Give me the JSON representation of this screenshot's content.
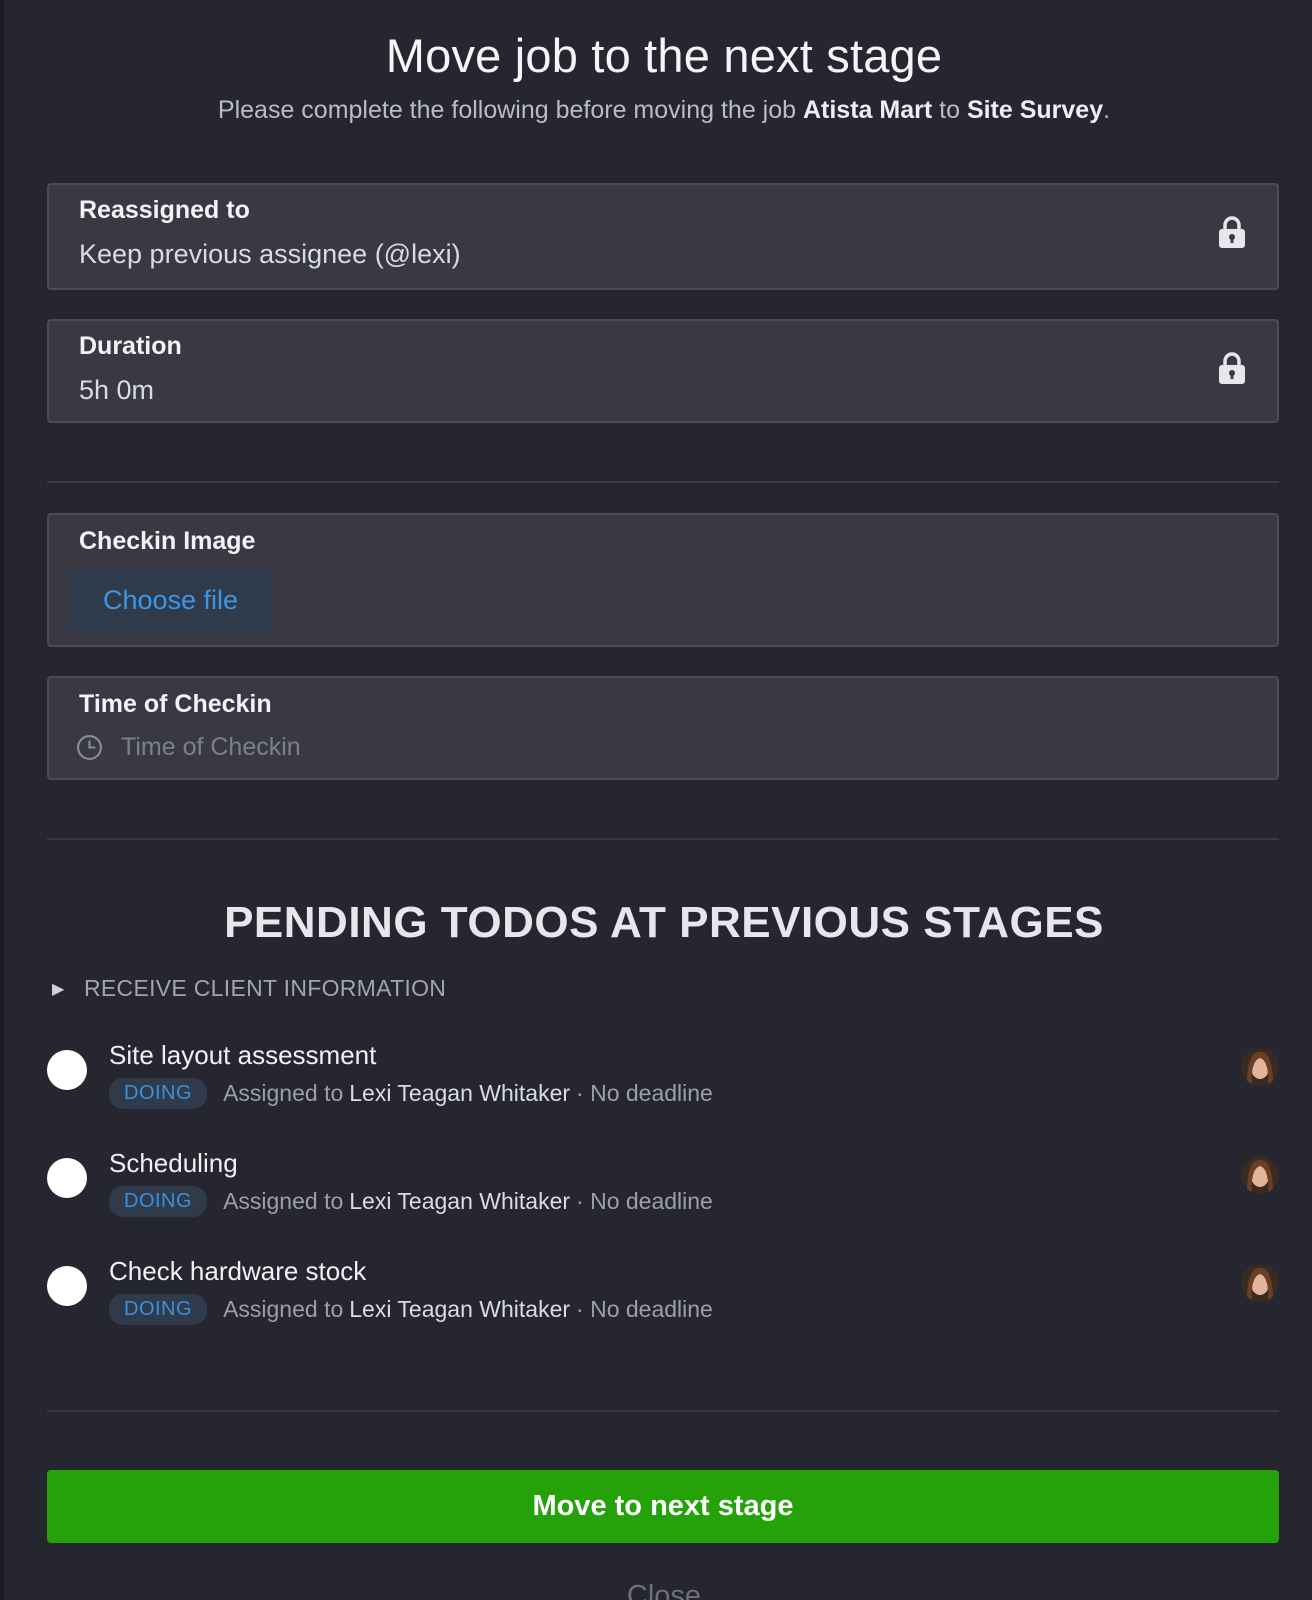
{
  "header": {
    "title": "Move job to the next stage",
    "subtitle_prefix": "Please complete the following before moving the job",
    "job_name": "Atista Mart",
    "subtitle_mid": "to",
    "stage_name": "Site Survey",
    "subtitle_end": "."
  },
  "fields": {
    "reassigned": {
      "label": "Reassigned to",
      "value": "Keep previous assignee (@lexi)",
      "icon": "lock-icon"
    },
    "duration": {
      "label": "Duration",
      "value": "5h 0m",
      "icon": "lock-icon"
    },
    "checkin_image": {
      "label": "Checkin Image",
      "button": "Choose file"
    },
    "checkin_time": {
      "label": "Time of Checkin",
      "placeholder": "Time of Checkin",
      "icon": "clock-icon"
    }
  },
  "pending": {
    "title": "PENDING TODOS AT PREVIOUS STAGES",
    "group": "RECEIVE CLIENT INFORMATION",
    "todos": [
      {
        "title": "Site layout assessment",
        "status": "DOING",
        "assigned_prefix": "Assigned to",
        "assignee": "Lexi Teagan Whitaker",
        "deadline": "· No deadline"
      },
      {
        "title": "Scheduling",
        "status": "DOING",
        "assigned_prefix": "Assigned to",
        "assignee": "Lexi Teagan Whitaker",
        "deadline": "· No deadline"
      },
      {
        "title": "Check hardware stock",
        "status": "DOING",
        "assigned_prefix": "Assigned to",
        "assignee": "Lexi Teagan Whitaker",
        "deadline": "· No deadline"
      }
    ]
  },
  "actions": {
    "primary": "Move to next stage",
    "close": "Close"
  },
  "colors": {
    "background": "#25262f",
    "field_bg": "#383942",
    "accent_blue": "#3d95e6",
    "primary_green": "#25a20a"
  }
}
